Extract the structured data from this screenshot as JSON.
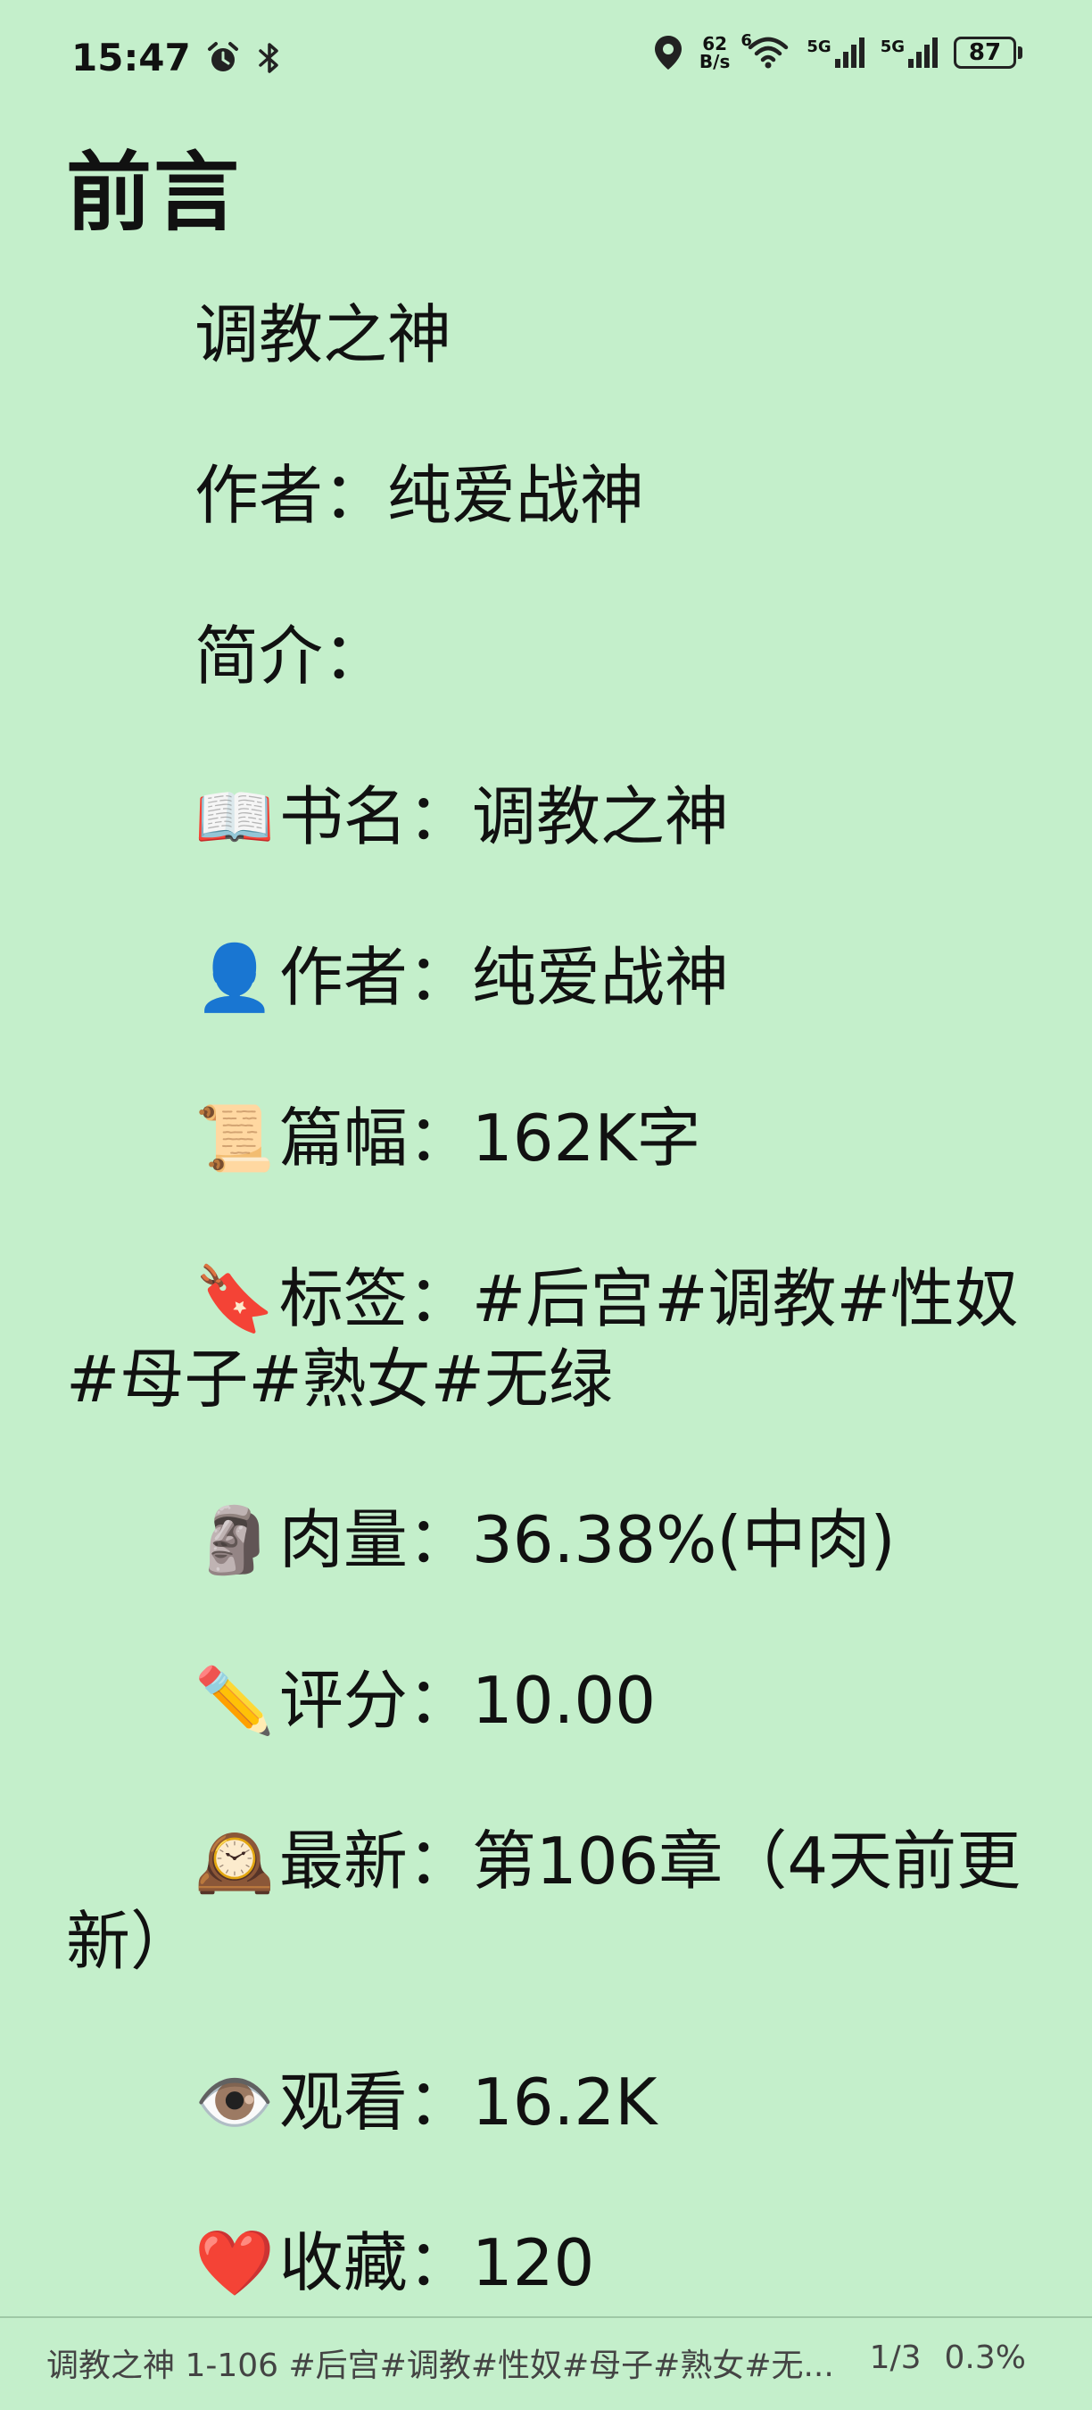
{
  "status_bar": {
    "time": "15:47",
    "alarm_icon": "alarm-icon",
    "bluetooth_icon": "bluetooth-icon",
    "location_icon": "location-icon",
    "net_speed_value": "62",
    "net_speed_unit": "B/s",
    "wifi_icon": "wifi-icon",
    "wifi_badge": "6",
    "sim1_label": "5G",
    "sim2_label": "5G",
    "battery": "87"
  },
  "title": "前言",
  "lines": {
    "book_title": "调教之神",
    "author": "作者：纯爱战神",
    "intro": "简介：",
    "name_emoji": "📖",
    "name": "书名：调教之神",
    "author_emoji": "👤",
    "author2": "作者：纯爱战神",
    "length_emoji": "📜",
    "length": "篇幅：162K字",
    "tags_emoji": "🔖",
    "tags": "标签：#后宫#调教#性奴#母子#熟女#无绿",
    "meat_emoji": "🗿",
    "meat": "肉量：36.38%(中肉)",
    "rating_emoji": "✏️",
    "rating": "评分：10.00",
    "latest_emoji": "🕰️",
    "latest": "最新：第106章（4天前更新）",
    "views_emoji": "👁️",
    "views": "观看：16.2K",
    "fav_emoji": "❤️",
    "fav": "收藏：120"
  },
  "footer": {
    "chapter_info": "调教之神 1-106 #后宫#调教#性奴#母子#熟女#无...",
    "page": "1/3",
    "progress": "0.3%"
  }
}
